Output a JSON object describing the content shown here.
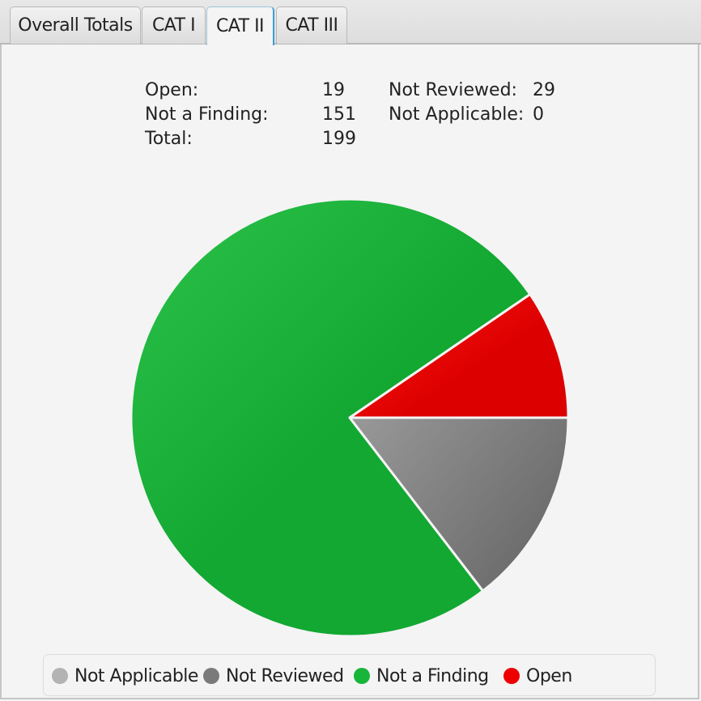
{
  "tabs": [
    {
      "label": "Overall Totals",
      "active": false
    },
    {
      "label": "CAT I",
      "active": false
    },
    {
      "label": "CAT II",
      "active": true
    },
    {
      "label": "CAT III",
      "active": false
    }
  ],
  "stats": {
    "open_label": "Open:",
    "open_value": "19",
    "naf_label": "Not a Finding:",
    "naf_value": "151",
    "total_label": "Total:",
    "total_value": "199",
    "nr_label": "Not Reviewed:",
    "nr_value": "29",
    "na_label": "Not Applicable:",
    "na_value": "0"
  },
  "chart_data": {
    "type": "pie",
    "title": "",
    "start_angle_deg": 0,
    "direction": "clockwise",
    "legend_position": "bottom",
    "slices": [
      {
        "label": "Not Applicable",
        "value": 0,
        "color": "#b3b3b3",
        "color_dark": "#9a9a9a"
      },
      {
        "label": "Not Reviewed",
        "value": 29,
        "color": "#999999",
        "color_dark": "#6e6e6e"
      },
      {
        "label": "Not a Finding",
        "value": 151,
        "color": "#2cc24a",
        "color_dark": "#12a832"
      },
      {
        "label": "Open",
        "value": 19,
        "color": "#f10d0d",
        "color_dark": "#dd0000"
      }
    ]
  },
  "legend": [
    {
      "label": "Not Applicable",
      "color": "#b3b3b3"
    },
    {
      "label": "Not Reviewed",
      "color": "#7a7a7a"
    },
    {
      "label": "Not a Finding",
      "color": "#17b53a"
    },
    {
      "label": "Open",
      "color": "#ee0000"
    }
  ]
}
